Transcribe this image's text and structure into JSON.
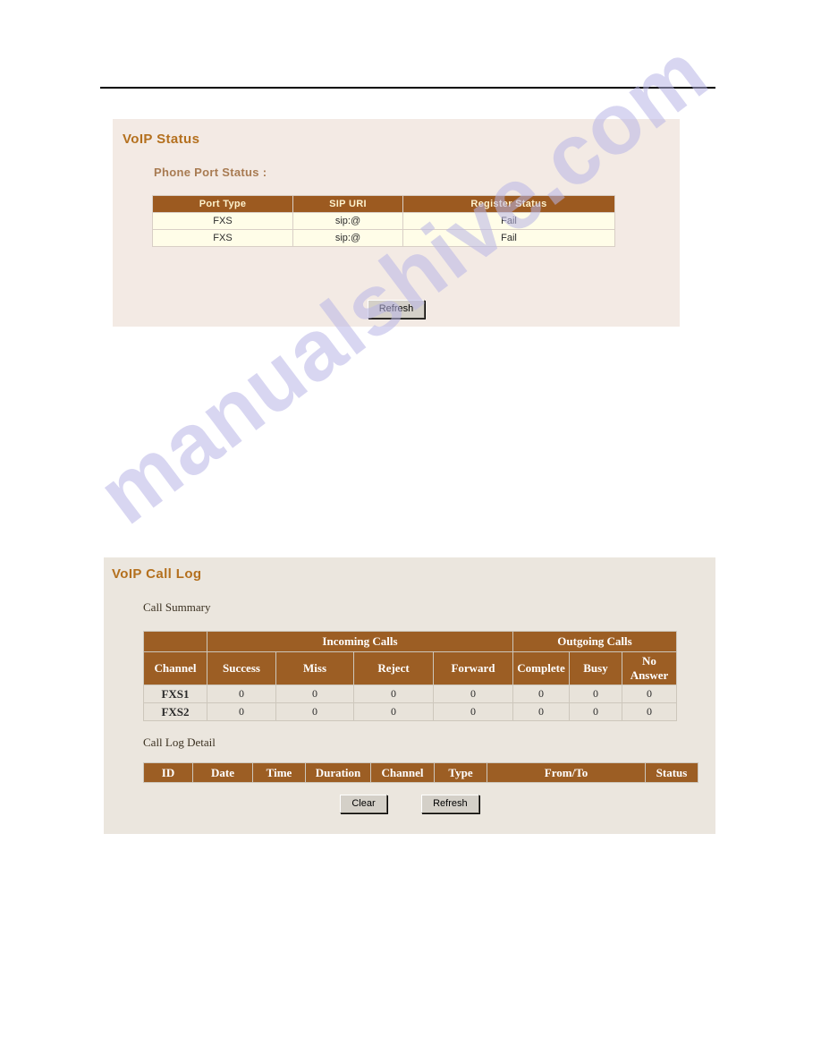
{
  "page": {
    "watermark": "manualshive.com"
  },
  "voip_status": {
    "panel_title": "VoIP Status",
    "section_label": "Phone Port Status :",
    "table": {
      "headers": [
        "Port Type",
        "SIP URI",
        "Register Status"
      ],
      "rows": [
        [
          "FXS",
          "sip:@",
          "Fail"
        ],
        [
          "FXS",
          "sip:@",
          "Fail"
        ]
      ]
    },
    "refresh_label": "Refresh"
  },
  "voip_call_log": {
    "panel_title": "VoIP Call Log",
    "call_summary_label": "Call Summary",
    "call_log_detail_label": "Call Log Detail",
    "summary_table": {
      "group_headers": [
        "",
        "Incoming Calls",
        "Outgoing Calls"
      ],
      "headers": [
        "Channel",
        "Success",
        "Miss",
        "Reject",
        "Forward",
        "Complete",
        "Busy",
        "No Answer"
      ],
      "header_noanswer_line1": "No",
      "header_noanswer_line2": "Answer",
      "rows": [
        {
          "channel": "FXS1",
          "success": "0",
          "miss": "0",
          "reject": "0",
          "forward": "0",
          "complete": "0",
          "busy": "0",
          "no_answer": "0"
        },
        {
          "channel": "FXS2",
          "success": "0",
          "miss": "0",
          "reject": "0",
          "forward": "0",
          "complete": "0",
          "busy": "0",
          "no_answer": "0"
        }
      ]
    },
    "detail_table": {
      "headers": [
        "ID",
        "Date",
        "Time",
        "Duration",
        "Channel",
        "Type",
        "From/To",
        "Status"
      ],
      "rows": []
    },
    "clear_label": "Clear",
    "refresh_label": "Refresh"
  },
  "colors": {
    "header_brown": "#9c5a20",
    "title_orange": "#b4701e",
    "panel_bg": "#f3eae4",
    "panel_bg_alt": "#ebe6de",
    "cell_ivory": "#fffde8",
    "cell_beige": "#e8e3da",
    "watermark_purple": "#b9b6e6"
  }
}
